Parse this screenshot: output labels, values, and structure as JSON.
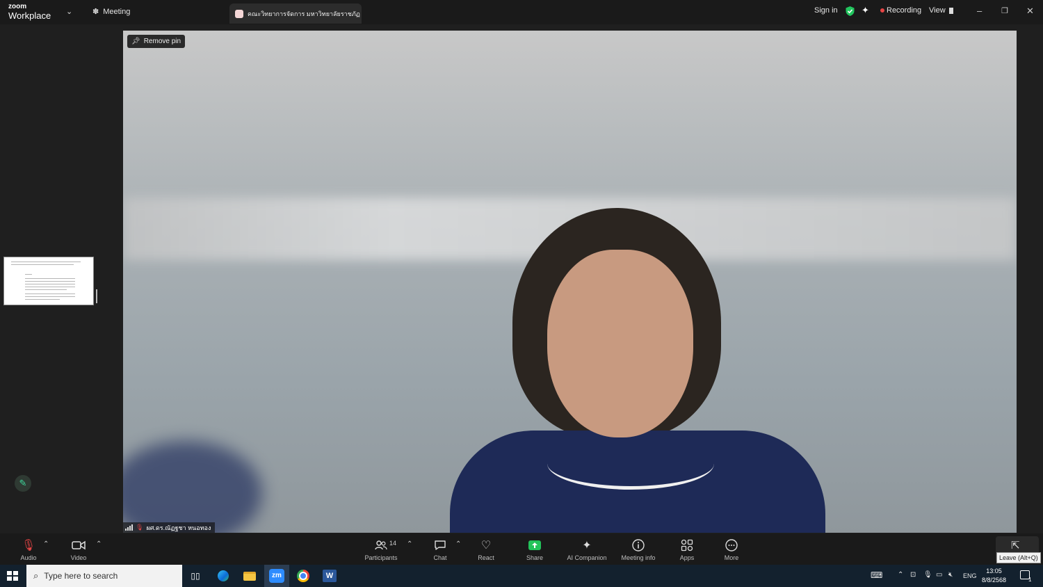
{
  "app": {
    "brand_top": "zoom",
    "brand_bottom": "Workplace"
  },
  "header": {
    "meeting_tab": "Meeting",
    "active_tab": "คณะวิทยาการจัดการ มหาวิทยาลัยราชภัฏ",
    "sign_in": "Sign in",
    "recording": "Recording",
    "view": "View"
  },
  "video": {
    "remove_pin": "Remove pin",
    "participant_name": "ผศ.ดร.ณัฏฐชา หนอทอง"
  },
  "toolbar": {
    "audio": "Audio",
    "video": "Video",
    "participants": "Participants",
    "participants_count": "14",
    "chat": "Chat",
    "react": "React",
    "share": "Share",
    "ai_companion": "AI Companion",
    "meeting_info": "Meeting info",
    "apps": "Apps",
    "more": "More",
    "leave_tooltip": "Leave (Alt+Q)"
  },
  "taskbar": {
    "search_placeholder": "Type here to search",
    "language": "ENG",
    "time": "13:05",
    "date": "8/8/2568",
    "notification_count": "1"
  },
  "colors": {
    "share_green": "#23c35a",
    "record_red": "#e64545",
    "annotate_green": "#3fd59a",
    "shield_green": "#22c55e"
  }
}
